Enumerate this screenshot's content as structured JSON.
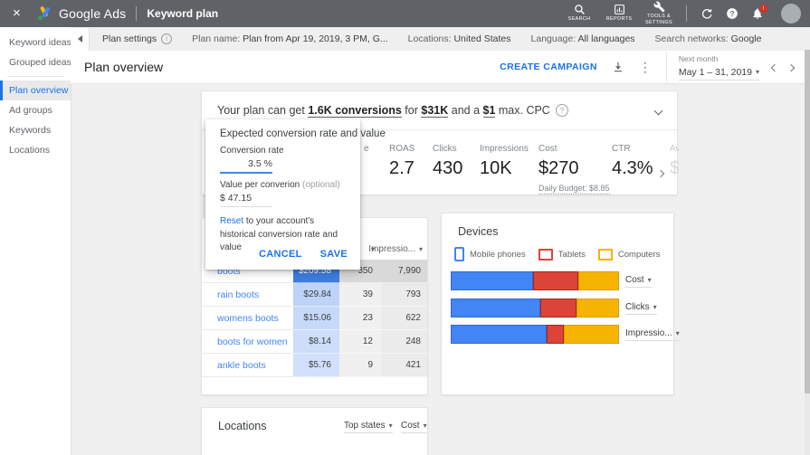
{
  "topbar": {
    "brand": "Google Ads",
    "page_title": "Keyword plan",
    "nav_search": "SEARCH",
    "nav_reports": "REPORTS",
    "nav_tools": "TOOLS & SETTINGS"
  },
  "settings_bar": {
    "title": "Plan settings",
    "plan_name_label": "Plan name:",
    "plan_name_value": "Plan from Apr 19, 2019, 3 PM, G...",
    "locations_label": "Locations:",
    "locations_value": "United States",
    "language_label": "Language:",
    "language_value": "All languages",
    "networks_label": "Search networks:",
    "networks_value": "Google"
  },
  "sidebar": {
    "items": [
      "Keyword ideas",
      "Grouped ideas",
      "Plan overview",
      "Ad groups",
      "Keywords",
      "Locations"
    ],
    "active_item": "Plan overview"
  },
  "header": {
    "title": "Plan overview",
    "create_campaign": "CREATE CAMPAIGN",
    "period_label": "Next month",
    "period_value": "May 1 – 31, 2019"
  },
  "banner": {
    "t1": "Your plan can get ",
    "conversions": "1.6K conversions",
    "t2": " for ",
    "cost": "$31K",
    "t3": " and a ",
    "cpc": "$1",
    "t4": " max. CPC"
  },
  "popup": {
    "title": "Expected conversion rate and value",
    "conversion_rate_label": "Conversion rate",
    "conversion_rate_value": "3.5 %",
    "value_label": "Value per converion ",
    "value_optional": "(optional)",
    "value_value": "$ 47.15",
    "reset_link": "Reset",
    "reset_text": " to your account's historical conversion rate and value",
    "cancel": "CANCEL",
    "save": "SAVE"
  },
  "metrics": {
    "hidden_fragment": "e",
    "items": [
      {
        "label": "ROAS",
        "value": "2.7"
      },
      {
        "label": "Clicks",
        "value": "430"
      },
      {
        "label": "Impressions",
        "value": "10K"
      },
      {
        "label": "Cost",
        "value": "$270",
        "sub": "Daily Budget: $8.85"
      },
      {
        "label": "CTR",
        "value": "4.3%"
      }
    ],
    "clipped_label": "Av",
    "clipped_value": "$"
  },
  "keywords_table": {
    "impressions_header": "Impressio...",
    "rows": [
      {
        "keyword": "boots",
        "cost": "$209.58",
        "clicks": "350",
        "impressions": "7,990"
      },
      {
        "keyword": "rain boots",
        "cost": "$29.84",
        "clicks": "39",
        "impressions": "793"
      },
      {
        "keyword": "womens boots",
        "cost": "$15.06",
        "clicks": "23",
        "impressions": "622"
      },
      {
        "keyword": "boots for women",
        "cost": "$8.14",
        "clicks": "12",
        "impressions": "248"
      },
      {
        "keyword": "ankle boots",
        "cost": "$5.76",
        "clicks": "9",
        "impressions": "421"
      }
    ]
  },
  "devices": {
    "title": "Devices",
    "legend": [
      {
        "label": "Mobile phones",
        "color": "#4285f4"
      },
      {
        "label": "Tablets",
        "color": "#db4437"
      },
      {
        "label": "Computers",
        "color": "#f4b400"
      }
    ],
    "bars": [
      {
        "label": "Cost",
        "mobile": 49,
        "tablet": 27,
        "computer": 24
      },
      {
        "label": "Clicks",
        "mobile": 53,
        "tablet": 22,
        "computer": 25
      },
      {
        "label": "Impressio...",
        "mobile": 57,
        "tablet": 10,
        "computer": 33
      }
    ]
  },
  "locations": {
    "title": "Locations",
    "dropdown_states": "Top states",
    "dropdown_metric": "Cost"
  },
  "colors": {
    "accent_blue": "#1a73e8",
    "chart_blue": "#4285f4",
    "chart_red": "#db4437",
    "chart_yellow": "#f4b400",
    "heatmap_strong_blue": "#3f7de0",
    "topbar_gray": "#5f6368",
    "badge_red": "#d93025"
  },
  "chart_data": {
    "type": "bar",
    "subtype": "horizontal-stacked-percent",
    "title": "Devices",
    "categories": [
      "Cost",
      "Clicks",
      "Impressions"
    ],
    "series": [
      {
        "name": "Mobile phones",
        "values": [
          49,
          53,
          57
        ]
      },
      {
        "name": "Tablets",
        "values": [
          27,
          22,
          10
        ]
      },
      {
        "name": "Computers",
        "values": [
          24,
          25,
          33
        ]
      }
    ],
    "legend_position": "top",
    "xlim": [
      0,
      100
    ]
  }
}
